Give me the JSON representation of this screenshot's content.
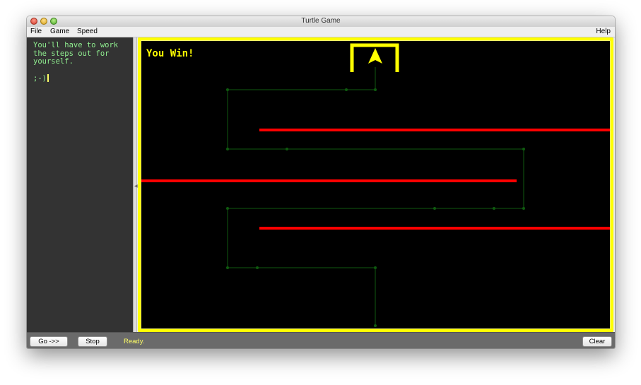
{
  "window": {
    "title": "Turtle Game"
  },
  "menus": {
    "file": "File",
    "game": "Game",
    "speed": "Speed",
    "help": "Help"
  },
  "editor": {
    "code": "You'll have to work\nthe steps out for\nyourself.\n\n;-)"
  },
  "game": {
    "message": "You Win!",
    "colors": {
      "border": "#ffff00",
      "background": "#000000",
      "wall": "#ff0000",
      "trail": "#0f5a0f",
      "turtle": "#ffff00",
      "message": "#ffff00"
    }
  },
  "toolbar": {
    "go": "Go ->>",
    "stop": "Stop",
    "clear": "Clear"
  },
  "status": {
    "text": "Ready."
  }
}
